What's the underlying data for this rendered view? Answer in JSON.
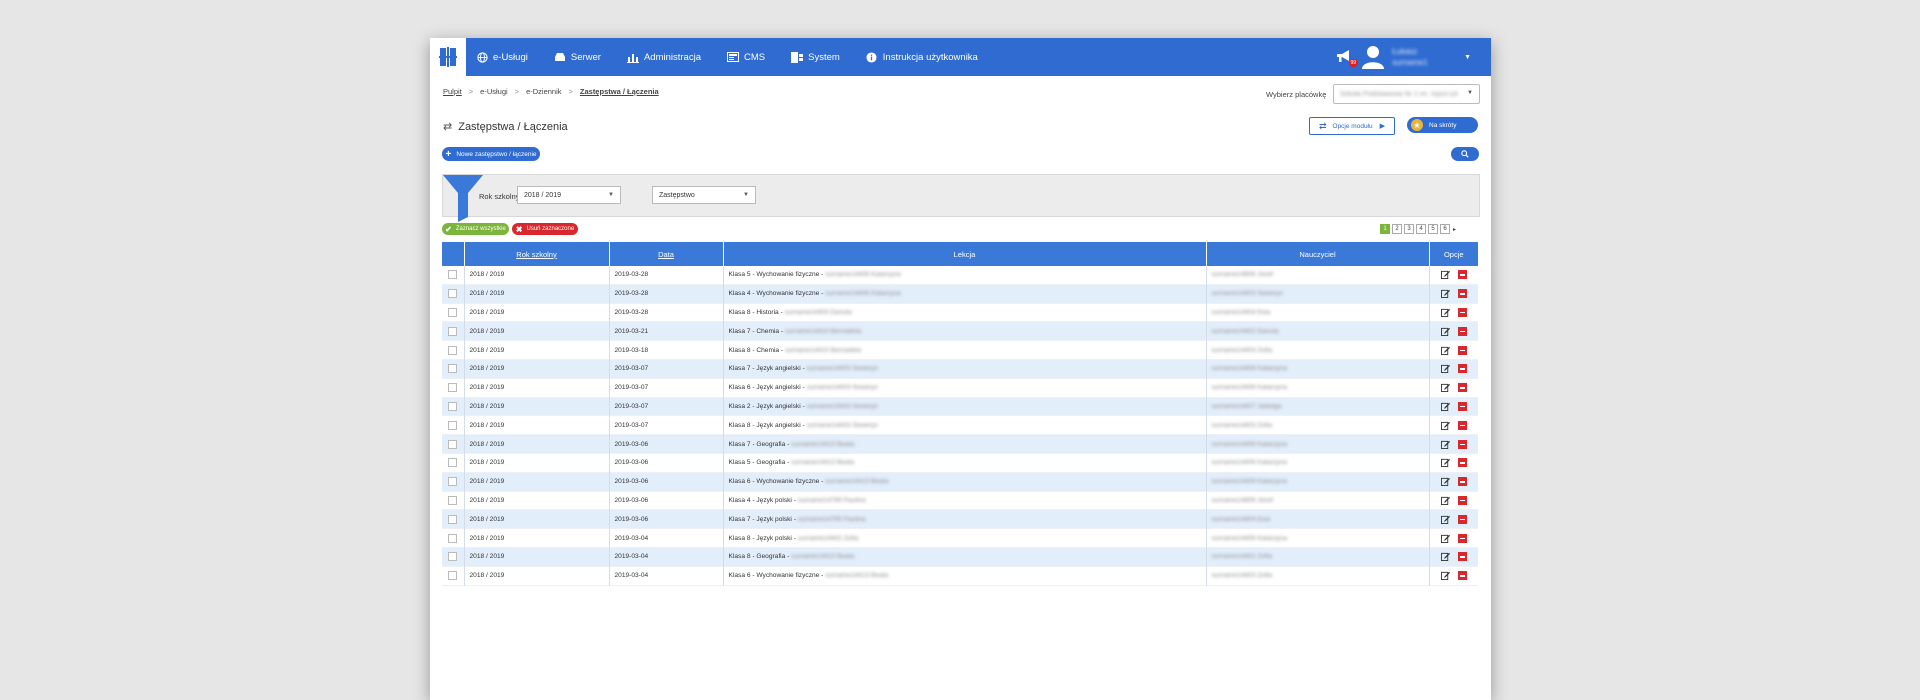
{
  "nav": {
    "items": [
      {
        "label": "e-Usługi",
        "icon": "globe-icon"
      },
      {
        "label": "Serwer",
        "icon": "server-icon"
      },
      {
        "label": "Administracja",
        "icon": "admin-icon"
      },
      {
        "label": "CMS",
        "icon": "cms-icon"
      },
      {
        "label": "System",
        "icon": "windows-icon"
      },
      {
        "label": "Instrukcja użytkownika",
        "icon": "info-icon"
      }
    ],
    "notification_badge": "99",
    "user": {
      "name_line1": "Łukasz",
      "name_line2": "surname1"
    }
  },
  "breadcrumb": {
    "items": [
      "Pulpit",
      "e-Usługi",
      "e-Dziennik",
      "Zastępstwa / Łączenia"
    ],
    "separator": ">"
  },
  "placowka": {
    "label": "Wybierz placówkę",
    "value": "Szkoła Podstawowa Nr 1 im. mjscł.szł..."
  },
  "page": {
    "title": "Zastępstwa / Łączenia"
  },
  "buttons": {
    "opcje_modulu": "Opcje modułu",
    "na_skroty": "Na skróty",
    "nowe": "Nowe zastępstwo / łączenie",
    "zaznacz": "Zaznacz wszystkie",
    "usun": "Usuń zaznaczone"
  },
  "filter": {
    "label": "Rok szkolny",
    "year_value": "2018 / 2019",
    "type_value": "Zastępstwo"
  },
  "pagination": {
    "pages": [
      "1",
      "2",
      "3",
      "4",
      "5",
      "6"
    ],
    "active": "1",
    "next": "▸"
  },
  "table": {
    "headers": {
      "rok": "Rok szkolny",
      "data": "Data",
      "lekcja": "Lekcja",
      "nauczyciel": "Nauczyciel",
      "opcje": "Opcje"
    },
    "rows": [
      {
        "rok": "2018 / 2019",
        "data": "2019-03-28",
        "lekcja": "Klasa 5 - Wychowanie fizyczne - ",
        "lekcja_name": "surname14406 Katarzyna",
        "nauczyciel": "surname14806 Józef"
      },
      {
        "rok": "2018 / 2019",
        "data": "2019-03-28",
        "lekcja": "Klasa 4 - Wychowanie fizyczne - ",
        "lekcja_name": "surname14406 Katarzyna",
        "nauczyciel": "surname14403 Seweryn"
      },
      {
        "rok": "2018 / 2019",
        "data": "2019-03-28",
        "lekcja": "Klasa 8 - Historia - ",
        "lekcja_name": "surname14403 Danuta",
        "nauczyciel": "surname14404 Ewa"
      },
      {
        "rok": "2018 / 2019",
        "data": "2019-03-21",
        "lekcja": "Klasa 7 - Chemia - ",
        "lekcja_name": "surname14410 Bernadeta",
        "nauczyciel": "surname14402 Danuta"
      },
      {
        "rok": "2018 / 2019",
        "data": "2019-03-18",
        "lekcja": "Klasa 8 - Chemia - ",
        "lekcja_name": "surname14410 Bernadeta",
        "nauczyciel": "surname14403 Zofia"
      },
      {
        "rok": "2018 / 2019",
        "data": "2019-03-07",
        "lekcja": "Klasa 7 - Język angielski - ",
        "lekcja_name": "surname14403 Seweryn",
        "nauczyciel": "surname14406 Katarzyna"
      },
      {
        "rok": "2018 / 2019",
        "data": "2019-03-07",
        "lekcja": "Klasa 6 - Język angielski - ",
        "lekcja_name": "surname14403 Seweryn",
        "nauczyciel": "surname14406 Katarzyna"
      },
      {
        "rok": "2018 / 2019",
        "data": "2019-03-07",
        "lekcja": "Klasa 2 - Język angielski - ",
        "lekcja_name": "surname14403 Seweryn",
        "nauczyciel": "surname14407 Jadwiga"
      },
      {
        "rok": "2018 / 2019",
        "data": "2019-03-07",
        "lekcja": "Klasa 8 - Język angielski - ",
        "lekcja_name": "surname14403 Seweryn",
        "nauczyciel": "surname14403 Zofia"
      },
      {
        "rok": "2018 / 2019",
        "data": "2019-03-06",
        "lekcja": "Klasa 7 - Geografia - ",
        "lekcja_name": "surname14413 Beata",
        "nauczyciel": "surname14406 Katarzyna"
      },
      {
        "rok": "2018 / 2019",
        "data": "2019-03-06",
        "lekcja": "Klasa 5 - Geografia - ",
        "lekcja_name": "surname14413 Beata",
        "nauczyciel": "surname14406 Katarzyna"
      },
      {
        "rok": "2018 / 2019",
        "data": "2019-03-06",
        "lekcja": "Klasa 6 - Wychowanie fizyczne - ",
        "lekcja_name": "surname14413 Beata",
        "nauczyciel": "surname14406 Katarzyna"
      },
      {
        "rok": "2018 / 2019",
        "data": "2019-03-06",
        "lekcja": "Klasa 4 - Język polski - ",
        "lekcja_name": "surname14795 Paulina",
        "nauczyciel": "surname14806 Józef"
      },
      {
        "rok": "2018 / 2019",
        "data": "2019-03-06",
        "lekcja": "Klasa 7 - Język polski - ",
        "lekcja_name": "surname14795 Paulina",
        "nauczyciel": "surname14404 Ewa"
      },
      {
        "rok": "2018 / 2019",
        "data": "2019-03-04",
        "lekcja": "Klasa 8 - Język polski - ",
        "lekcja_name": "surname14402 Zofia",
        "nauczyciel": "surname14406 Katarzyna"
      },
      {
        "rok": "2018 / 2019",
        "data": "2019-03-04",
        "lekcja": "Klasa 8 - Geografia - ",
        "lekcja_name": "surname14413 Beata",
        "nauczyciel": "surname14402 Zofia"
      },
      {
        "rok": "2018 / 2019",
        "data": "2019-03-04",
        "lekcja": "Klasa 6 - Wychowanie fizyczne - ",
        "lekcja_name": "surname14413 Beata",
        "nauczyciel": "surname14403 Zofia"
      }
    ]
  },
  "colors": {
    "primary": "#2f6bd1",
    "header": "#3b79d8",
    "row_alt": "#e3eefb",
    "success": "#7bb53b",
    "danger": "#d8272d"
  }
}
